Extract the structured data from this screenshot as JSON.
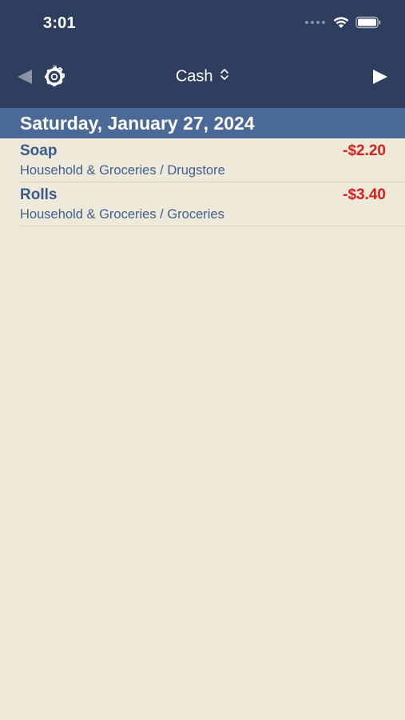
{
  "status_bar": {
    "time": "3:01"
  },
  "nav": {
    "prev_icon": "triangle-left-icon",
    "settings_icon": "gear-icon",
    "account": "Cash",
    "account_chevron_icon": "chevron-up-down-icon",
    "next_icon": "triangle-right-icon"
  },
  "date_header": "Saturday, January 27, 2024",
  "transactions": [
    {
      "name": "Soap",
      "category": "Household & Groceries / Drugstore",
      "amount": "-$2.20"
    },
    {
      "name": "Rolls",
      "category": "Household & Groceries / Groceries",
      "amount": "-$3.40"
    }
  ],
  "colors": {
    "header_bg": "#2f3d5e",
    "date_bar_bg": "#4a6997",
    "background": "#efe9da",
    "amount_negative": "#d5201a",
    "text_accent": "#3a5a8c"
  }
}
